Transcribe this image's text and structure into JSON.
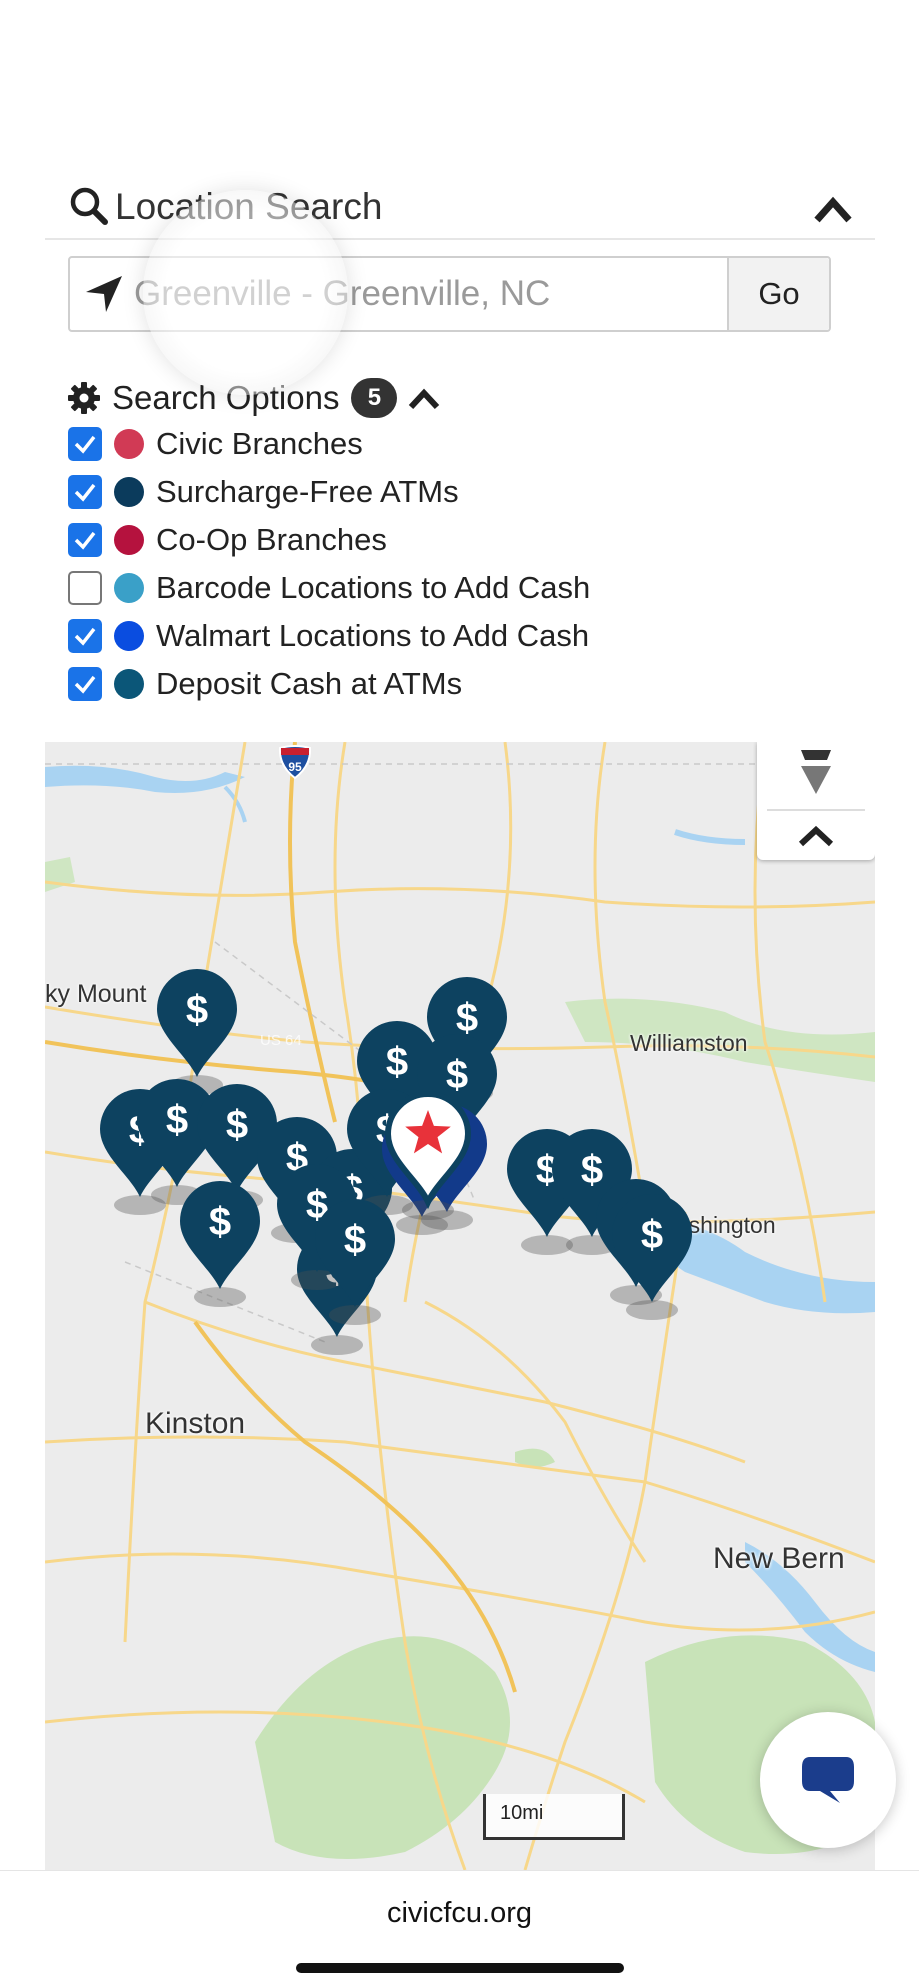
{
  "location_search": {
    "title": "Location Search",
    "input_value": "",
    "input_placeholder": "Greenville - Greenville, NC",
    "go_label": "Go"
  },
  "search_options": {
    "title": "Search Options",
    "count": "5",
    "items": [
      {
        "label": "Civic Branches",
        "checked": true,
        "color": "#d13a55"
      },
      {
        "label": "Surcharge-Free ATMs",
        "checked": true,
        "color": "#0b3b5c"
      },
      {
        "label": "Co-Op Branches",
        "checked": true,
        "color": "#b5123e"
      },
      {
        "label": "Barcode Locations to Add Cash",
        "checked": false,
        "color": "#3aa0c8"
      },
      {
        "label": "Walmart Locations to Add Cash",
        "checked": true,
        "color": "#0a4de0"
      },
      {
        "label": "Deposit Cash at ATMs",
        "checked": true,
        "color": "#0b5678"
      }
    ]
  },
  "map": {
    "places": {
      "rocky_mount": "ky Mount",
      "williamston": "Williamston",
      "washington": "Washington",
      "kinston": "Kinston",
      "new_bern": "New Bern",
      "highway_95": "95",
      "us64": "US 64"
    },
    "scale_label": "10mi",
    "pin_color": "#0d4260",
    "home_pin_color": "#e8323a"
  },
  "footer": {
    "url": "civicfcu.org"
  },
  "colors": {
    "accent": "#1a73e8",
    "chat_icon": "#1b3d8c"
  }
}
